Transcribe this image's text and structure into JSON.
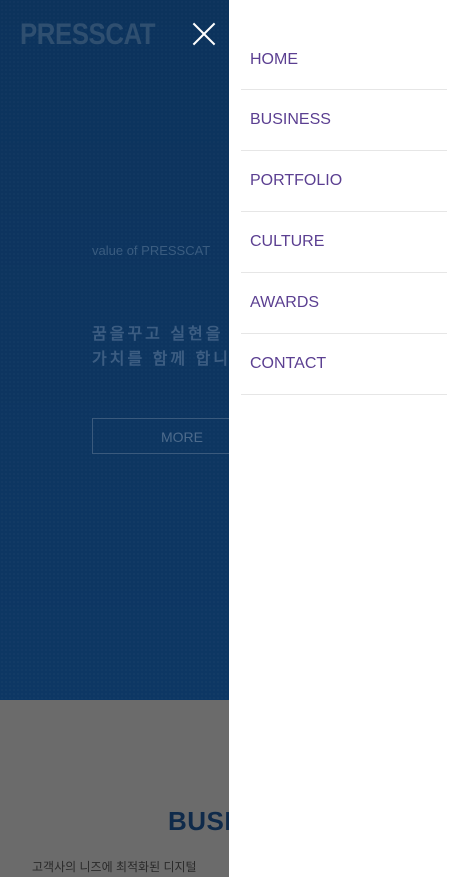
{
  "header": {
    "logo_text": "PRESSCAT",
    "close_icon": "close-icon"
  },
  "hero": {
    "eyebrow": "value of PRESSCAT",
    "headline_line1": "꿈을꾸고 실현을",
    "headline_line2": "가치를 함께 합니",
    "more_label": "MORE"
  },
  "business": {
    "title": "BUSI",
    "description": "고객사의 니즈에 최적화된 디지털"
  },
  "menu": {
    "items": [
      {
        "label": "HOME"
      },
      {
        "label": "BUSINESS"
      },
      {
        "label": "PORTFOLIO"
      },
      {
        "label": "CULTURE"
      },
      {
        "label": "AWARDS"
      },
      {
        "label": "CONTACT"
      }
    ]
  },
  "colors": {
    "hero_bg": "#0e3a69",
    "menu_text": "#5b3f91",
    "drawer_bg": "#ffffff"
  }
}
